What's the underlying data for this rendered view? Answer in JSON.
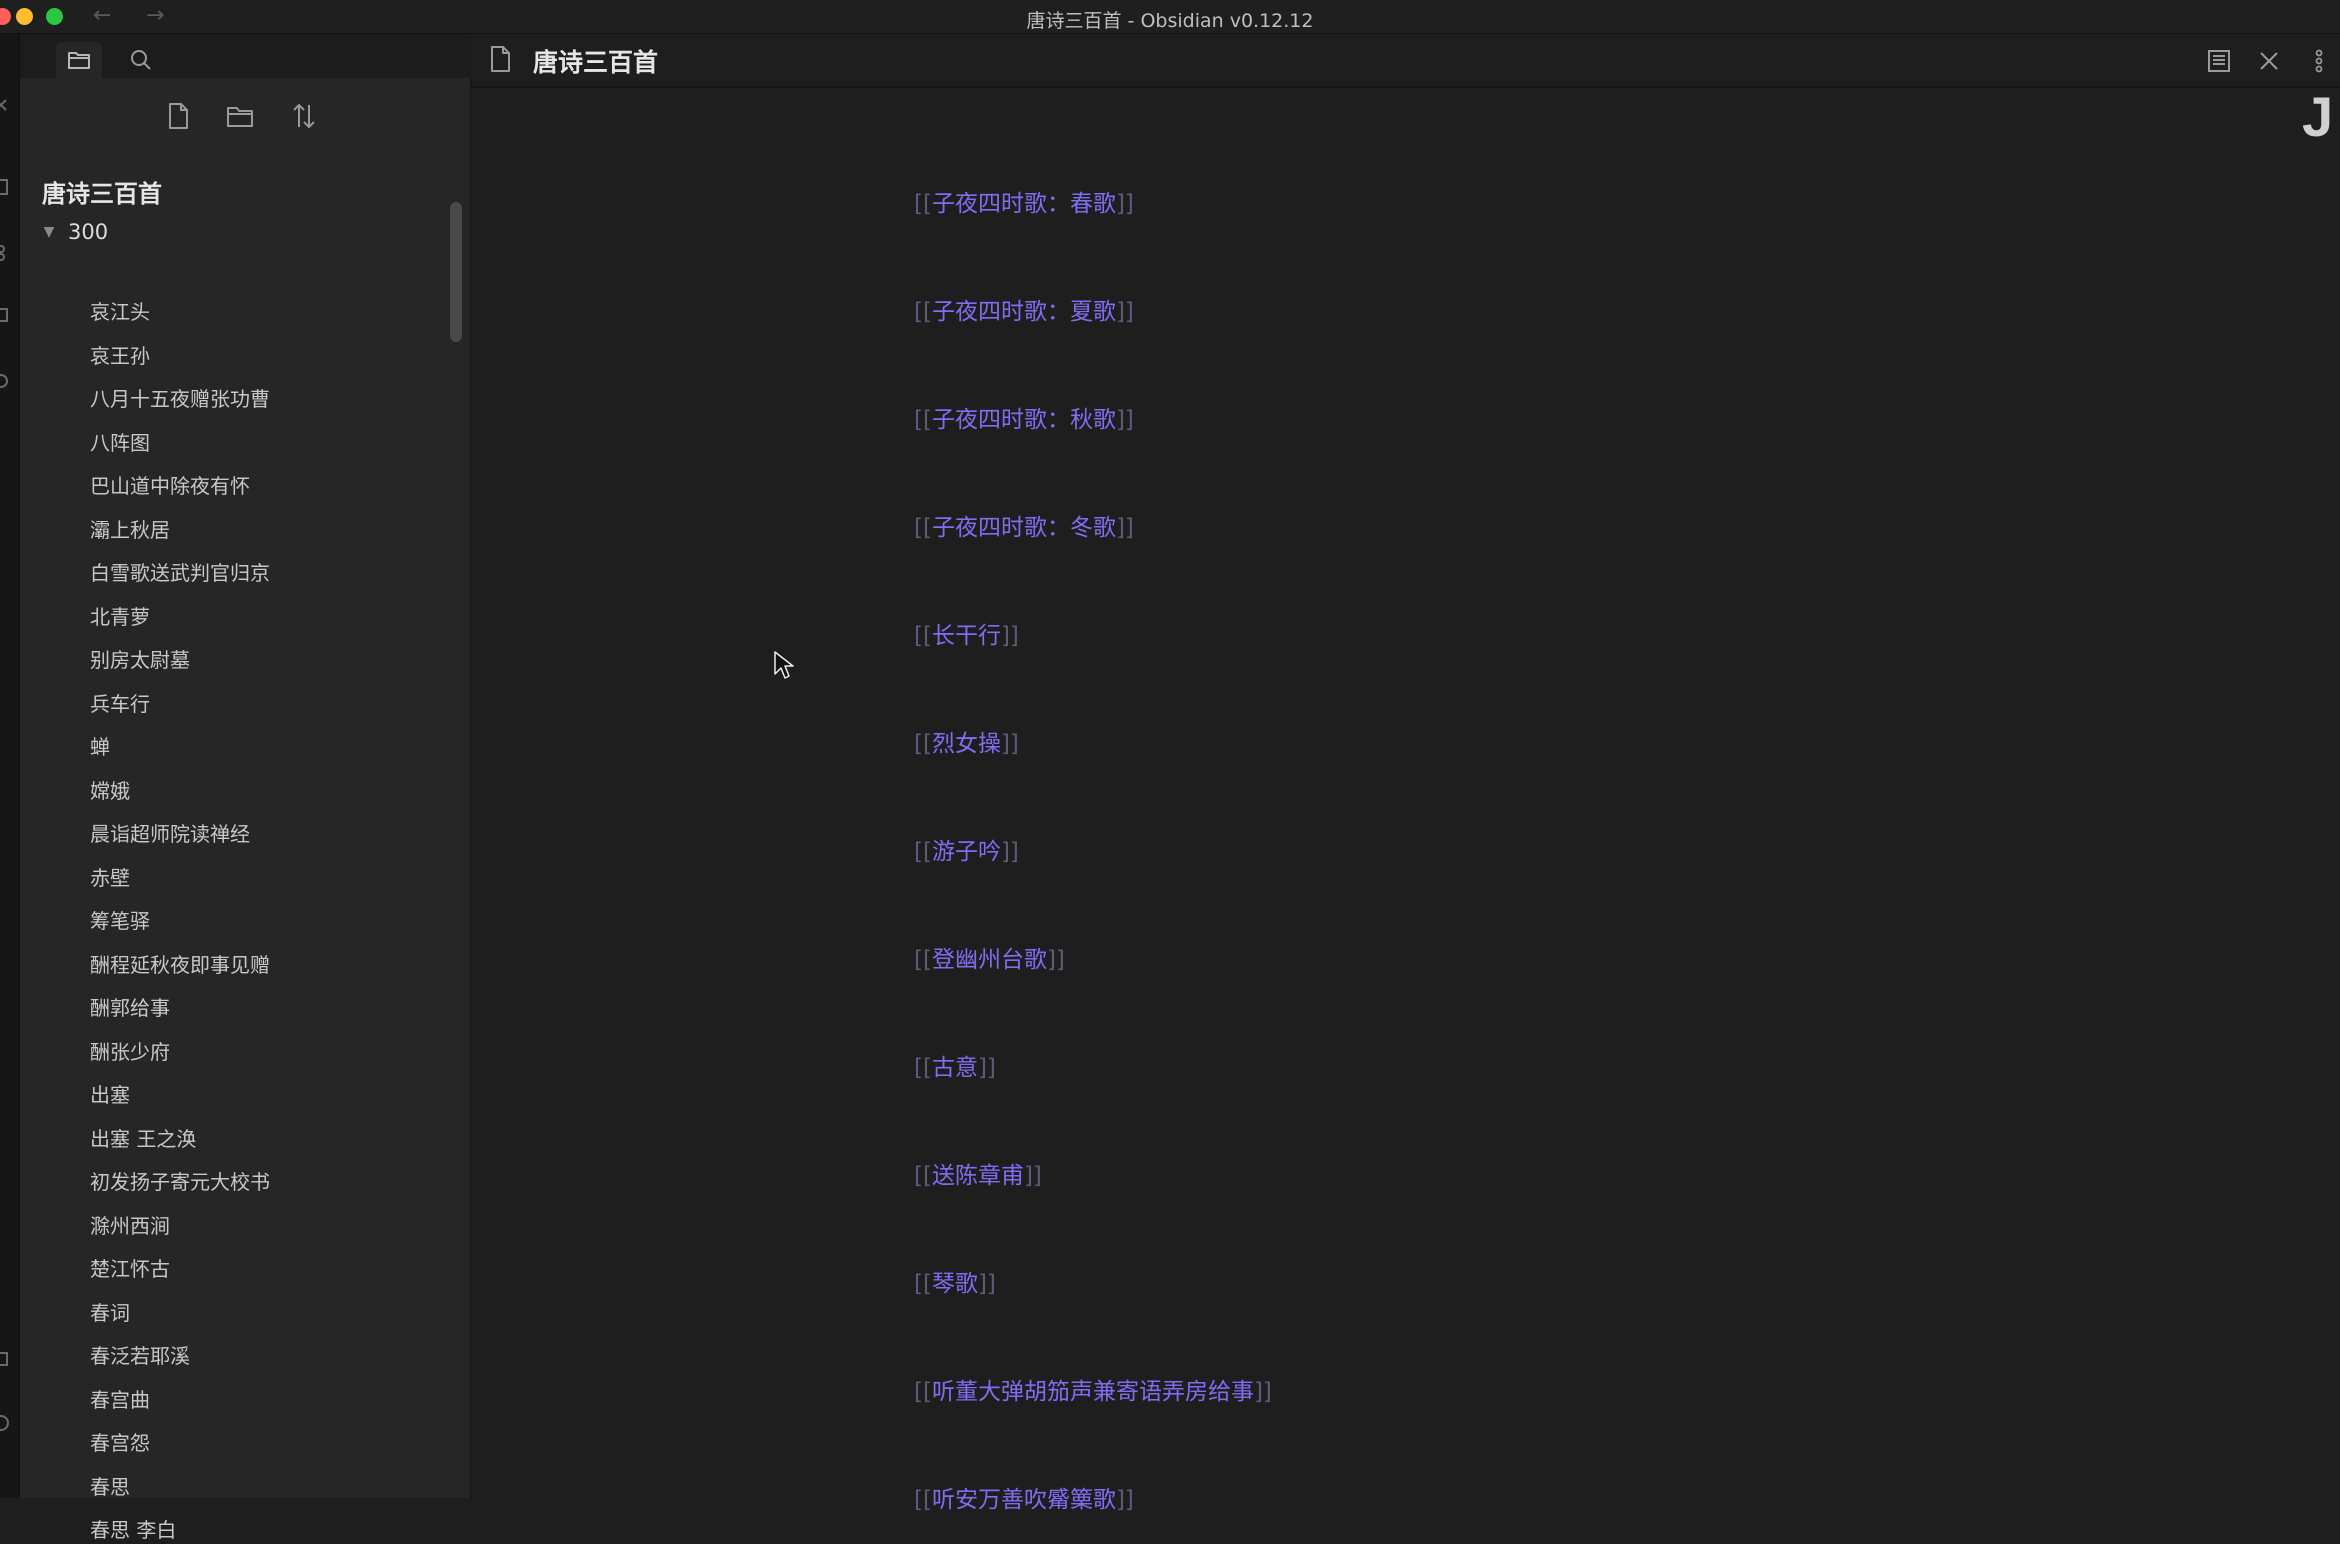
{
  "window": {
    "title": "唐诗三百首 - Obsidian v0.12.12"
  },
  "sidebar": {
    "vault_title": "唐诗三百首",
    "folder": {
      "name": "300",
      "expanded": true
    },
    "files": [
      "哀江头",
      "哀王孙",
      "八月十五夜赠张功曹",
      "八阵图",
      "巴山道中除夜有怀",
      "灞上秋居",
      "白雪歌送武判官归京",
      "北青萝",
      "别房太尉墓",
      "兵车行",
      "蝉",
      "嫦娥",
      "晨诣超师院读禅经",
      "赤壁",
      "筹笔驿",
      "酬程延秋夜即事见赠",
      "酬郭给事",
      "酬张少府",
      "出塞",
      "出塞 王之涣",
      "初发扬子寄元大校书",
      "滁州西涧",
      "楚江怀古",
      "春词",
      "春泛若耶溪",
      "春宫曲",
      "春宫怨",
      "春思",
      "春思 李白"
    ]
  },
  "view": {
    "title": "唐诗三百首",
    "links": [
      "子夜四时歌：春歌",
      "子夜四时歌：夏歌",
      "子夜四时歌：秋歌",
      "子夜四时歌：冬歌",
      "长干行",
      "烈女操",
      "游子吟",
      "登幽州台歌",
      "古意",
      "送陈章甫",
      "琴歌",
      "听董大弹胡笳声兼寄语弄房给事",
      "听安万善吹觱篥歌"
    ],
    "bracket_open": "[[",
    "bracket_close": "]]"
  },
  "corner_glyph": "J",
  "colors": {
    "link": "#7f6df2",
    "bracket": "#5b5b78",
    "background": "#1e1e1e",
    "sidebar": "#262626"
  },
  "icons": {
    "ribbon": [
      "collapse-icon",
      "file-explorer-icon",
      "graph-icon",
      "calendar-icon",
      "command-icon",
      "vault-icon",
      "help-icon"
    ],
    "sidebar_tabs": [
      "folder-icon",
      "search-icon"
    ],
    "toolbar": [
      "new-note-icon",
      "new-folder-icon",
      "sort-icon"
    ],
    "header": [
      "file-icon",
      "reading-view-icon",
      "close-icon",
      "more-options-icon"
    ]
  }
}
